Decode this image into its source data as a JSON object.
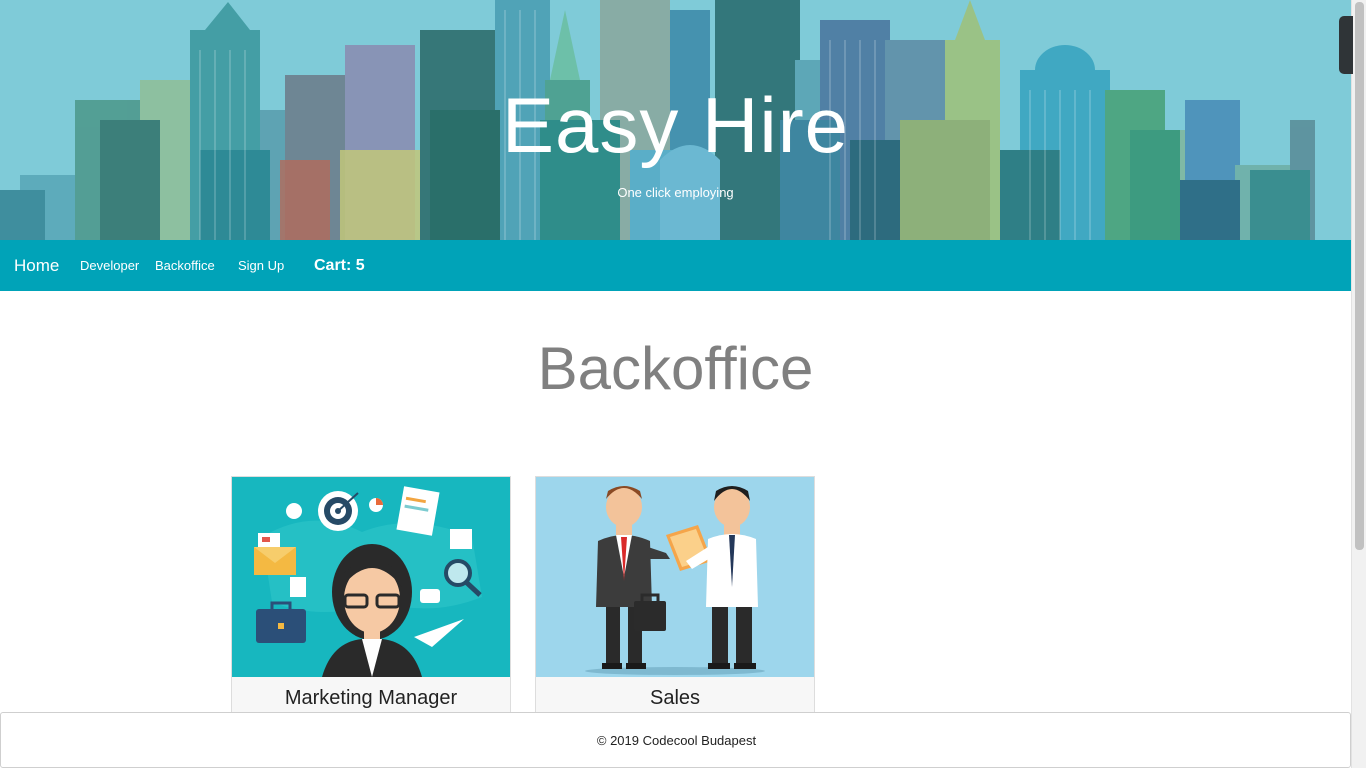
{
  "hero": {
    "title": "Easy Hire",
    "subtitle": "One click employing"
  },
  "nav": {
    "home": "Home",
    "developer": "Developer",
    "backoffice": "Backoffice",
    "signup": "Sign Up",
    "cart": "Cart: 5"
  },
  "page": {
    "title": "Backoffice"
  },
  "cards": [
    {
      "title": "Marketing Manager",
      "image": "marketing-manager-illustration"
    },
    {
      "title": "Sales",
      "image": "sales-handshake-illustration"
    }
  ],
  "footer": {
    "text": "© 2019 Codecool Budapest"
  },
  "colors": {
    "hero_sky": "#7fcbd8",
    "navbar": "#00a3b8",
    "title_gray": "#808080"
  }
}
